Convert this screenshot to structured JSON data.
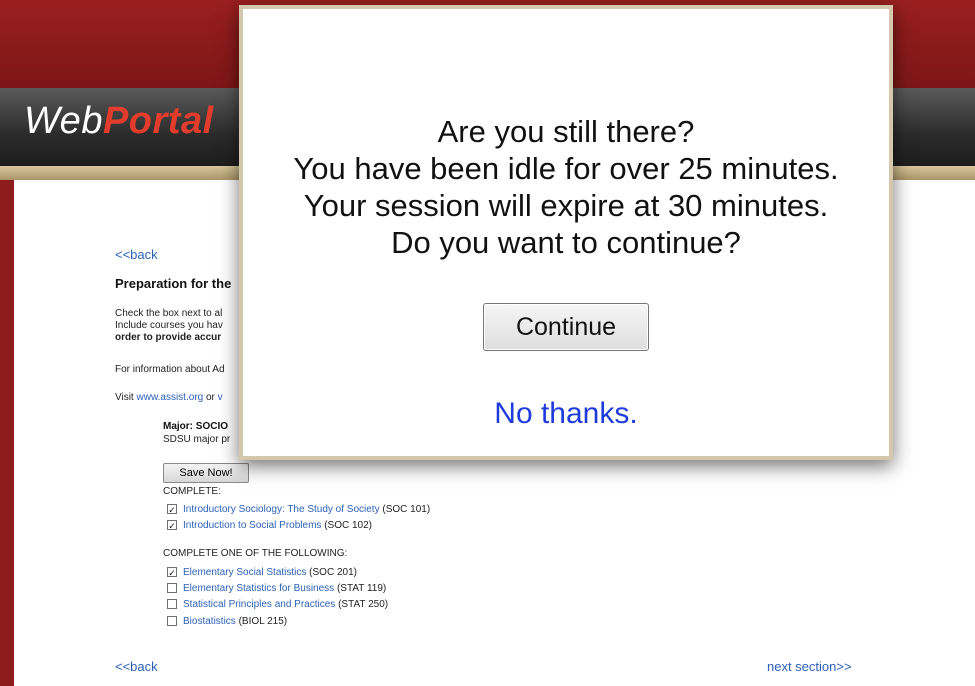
{
  "header": {
    "logo_web": "Web",
    "logo_portal": "Portal"
  },
  "page": {
    "back_top": "<<back",
    "prep_title": "Preparation for the",
    "instr_lines": [
      "Check the box next to al",
      "Include courses you hav"
    ],
    "instr_bold": "order to provide accur",
    "info_line": "For information about Ad",
    "visit_prefix": "Visit ",
    "visit_link": "www.assist.org",
    "visit_or": " or ",
    "visit_link2": "v",
    "major_title": "Major: SOCIO",
    "major_sub": "SDSU major pr",
    "save_button": "Save Now!",
    "complete_label": "COMPLETE:",
    "complete_courses": [
      {
        "name": "Introductory Sociology: The Study of Society",
        "code": "(SOC 101)",
        "checked": true
      },
      {
        "name": "Introduction to Social Problems",
        "code": "(SOC 102)",
        "checked": true
      }
    ],
    "one_of_label": "COMPLETE ONE OF THE FOLLOWING:",
    "one_of_courses": [
      {
        "name": "Elementary Social Statistics",
        "code": "(SOC 201)",
        "checked": true
      },
      {
        "name": "Elementary Statistics for Business",
        "code": "(STAT 119)",
        "checked": false
      },
      {
        "name": "Statistical Principles and Practices",
        "code": "(STAT 250)",
        "checked": false
      },
      {
        "name": "Biostatistics",
        "code": "(BIOL 215)",
        "checked": false
      }
    ],
    "back_bottom": "<<back",
    "next_section": "next section>>"
  },
  "modal": {
    "lines": [
      "Are you still there?",
      "You have been idle for over 25 minutes.",
      "Your session will expire at 30 minutes.",
      "Do you want to continue?"
    ],
    "continue_label": "Continue",
    "no_thanks": "No thanks."
  }
}
